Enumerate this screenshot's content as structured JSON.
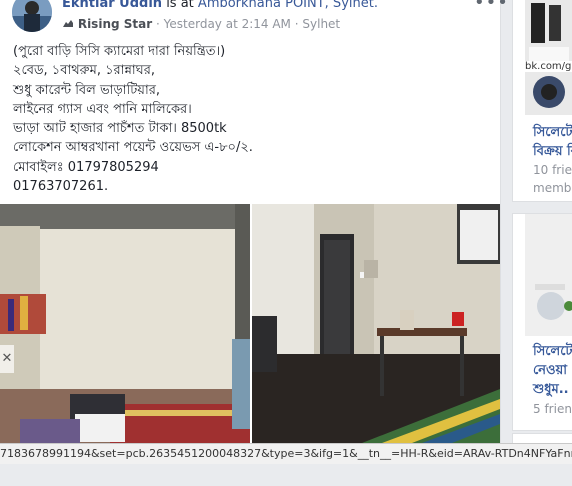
{
  "post": {
    "author": "Ekhtiar Uddin",
    "location_prefix": "is at",
    "location": "Amborkhana POINT, Sylhet.",
    "badge": "Rising Star",
    "separator1": "·",
    "time": "Yesterday at 2:14 AM",
    "separator2": "·",
    "place": "Sylhet",
    "lines": [
      "(পুরো বাড়ি সিসি ক্যামেরা দারা নিয়ন্ত্রিত।)",
      "২বেড, ১বাথরুম, ১রান্নাঘর,",
      "শুধু কারেন্ট বিল ভাড়াটিয়ার,",
      "লাইনের গ্যাস এবং পানি মালিকের।",
      "ভাড়া আট হাজার পাচঁশত টাকা। 8500tk",
      "লোকেশন আম্বরখানা পয়েন্ট ওয়েভস এ-৮০/২.",
      "মোবাইলঃ 01797805294",
      "01763707261."
    ]
  },
  "sidebar": {
    "card1": {
      "url_fragment": "bk.com/gro",
      "title1": "সিলেটে",
      "title2": "বিক্রয় বি",
      "sub1": "10 frien",
      "sub2": "membe"
    },
    "card2": {
      "title1": "সিলেটে",
      "title2": "নেওয়া",
      "title3": "শুধুম..",
      "sub1": "5 friend"
    }
  },
  "statusbar": {
    "url": "7183678991194&set=pcb.2635451200048327&type=3&ifg=1&__tn__=HH-R&eid=ARAv-RTDn4NFYaFnmT0"
  },
  "icons": {
    "more": "more-options-icon",
    "badge": "rising-star-badge-icon",
    "nav": "close-icon"
  }
}
